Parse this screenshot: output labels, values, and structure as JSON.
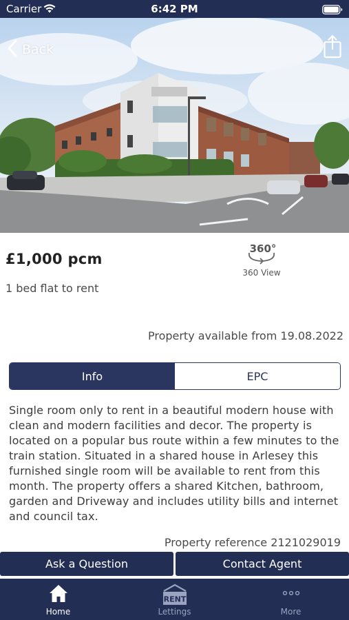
{
  "status_bar": {
    "carrier": "Carrier",
    "time": "6:42 PM"
  },
  "header": {
    "back_label": "Back"
  },
  "property": {
    "price": "£1,000 pcm",
    "subtitle": "1 bed flat to rent",
    "view_360_label": "360 View",
    "availability": "Property available from 19.08.2022",
    "description": "Single room only to rent in a beautiful modern house with clean and modern facilities and decor. The property is located on a popular bus route within a few minutes to the train station. Situated in a shared house in Arlesey this furnished single room will be available to rent from this month. The property offers a shared Kitchen, bathroom, garden and Driveway and includes utility bills and internet and council tax.",
    "reference": "Property reference 2121029019"
  },
  "tabs": [
    {
      "label": "Info",
      "active": true
    },
    {
      "label": "EPC",
      "active": false
    }
  ],
  "actions": {
    "ask_label": "Ask a Question",
    "contact_label": "Contact Agent"
  },
  "tabbar": [
    {
      "label": "Home",
      "icon": "home-icon",
      "active": true
    },
    {
      "label": "Lettings",
      "icon": "rent-sign-icon",
      "active": false
    },
    {
      "label": "More",
      "icon": "more-dots-icon",
      "active": false
    }
  ],
  "colors": {
    "navy": "#232e55",
    "tab_navy": "#2a3560",
    "inactive_tab_text": "#9aa3c0"
  },
  "icons": {
    "wifi": "wifi-icon",
    "battery": "battery-icon",
    "back": "chevron-left-icon",
    "share": "share-icon",
    "view_360": "360-view-icon"
  },
  "rent_sign_text": "RENT",
  "view_360_badge": "360°"
}
